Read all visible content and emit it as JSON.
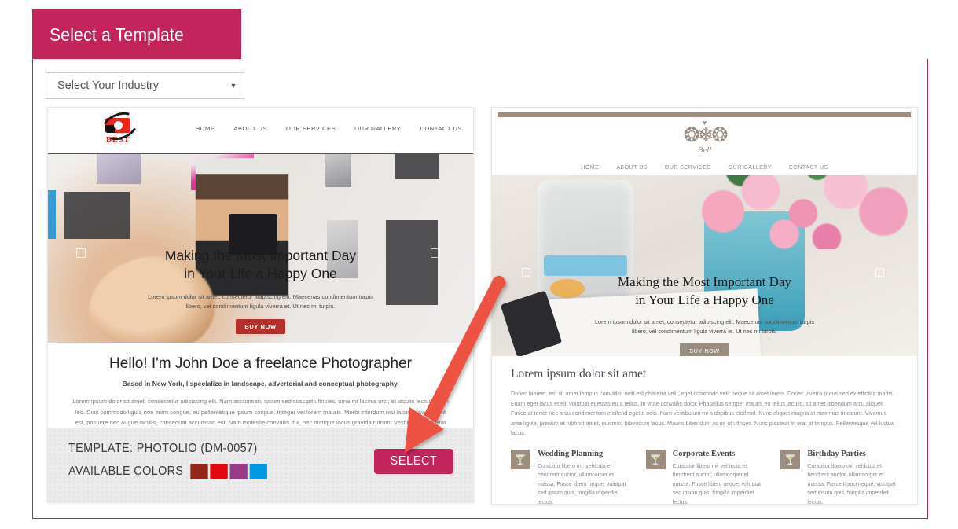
{
  "header": {
    "title": "Select a Template",
    "accent_color": "#c4245c"
  },
  "industry_select": {
    "value": "Select Your Industry",
    "caret": "▼"
  },
  "templates": [
    {
      "id": "photolio",
      "logo": {
        "brand": "BEST",
        "icon": "camera-icon"
      },
      "nav": [
        "HOME",
        "ABOUT US",
        "OUR SERVICES",
        "OUR GALLERY",
        "CONTACT US"
      ],
      "hero": {
        "heading_line1": "Making the Most Important Day",
        "heading_line2": "in Your Life a Happy One",
        "paragraph": "Lorem ipsum dolor sit amet, consectetur adipiscing elit. Maecenas condimentum turpis libero, vel condimentum ligula viverra et. Ut nec mi turpis.",
        "cta": "BUY NOW"
      },
      "body": {
        "title": "Hello! I'm John Doe a freelance Photographer",
        "subtitle": "Based in New York, I specialize in landscape, advertorial and conceptual photography.",
        "paragraph": "Lorem ipsum dolor sit amet, consectetur adipiscing elit. Nam accumsan, ipsum sed suscipit ultricies, urna mi lacinia orci, et iaculis lectus nisi in leo. Duis commodo ligula non enim congue, eu pellentesque ipsum congue. Integer vel lorem mauris. Morbi interdum nisi lacus. Vivamus elit est, posuere nec augue iaculis, consequat accumsan est. Nam molestie convallis dui, nec tristique lacus gravida rutrum. Vestibulum placerat magna odio, in viverra justo tincidunt sed. Vestibulum maximus orci placerat hendrerit elementum."
      },
      "footer": {
        "template_label": "TEMPLATE: PHOTOLIO (DM-0057)",
        "colors_label": "AVAILABLE COLORS",
        "colors": [
          "#94251b",
          "#e30613",
          "#963c86",
          "#0099e0"
        ],
        "select_button": "SELECT"
      }
    },
    {
      "id": "wedding",
      "logo": {
        "brand": "Bell",
        "icon": "floral-crest-icon"
      },
      "nav": [
        "HOME",
        "ABOUT US",
        "OUR SERVICES",
        "OUR GALLERY",
        "CONTACT US"
      ],
      "hero": {
        "heading_line1": "Making the Most Important Day",
        "heading_line2": "in Your Life a Happy One",
        "paragraph": "Lorem ipsum dolor sit amet, consectetur adipiscing elit. Maecenas condimentum turpis libero, vel condimentum ligula viverra et. Ut nec mi turpis.",
        "cta": "BUY NOW"
      },
      "body": {
        "title": "Lorem ipsum dolor sit amet",
        "paragraph": "Donec laoreet, est sit amet tempus convallis, velit est pharetra velit, eget commodo velit neque sit amet lorem. Donec viverra purus sed ex efficitur mattis. Etiam eget lacus et elit volutpat egestas eu a tellus. In vitae convallis dolor. Phasellus semper mauris eu tellus iaculis, sit amet bibendum arcu aliquet. Fusce at tortor nec arcu condimentum eleifend eget a odio. Nam vestibulum mi a dapibus eleifend. Nunc aliquet magna at maximus tincidunt. Vivamus ante ligula, pretium et nibh sit amet, euismod bibendum lacus. Mauris bibendum ac ex at ultrices. Nunc placerat in erat at tempus. Pellentesque vel luctus lacus."
      },
      "services": [
        {
          "icon": "cocktail-glass-icon",
          "title": "Wedding Planning",
          "text": "Curabitur libero mi, vehicula et hendrerit auctor, ullamcorper et massa. Fusce libero neque, volutpat sed ipsum quis, fringilla imperdiet lectus."
        },
        {
          "icon": "cocktail-glass-icon",
          "title": "Corporate Events",
          "text": "Curabitur libero mi, vehicula et hendrerit auctor, ullamcorper et massa. Fusce libero neque, volutpat sed ipsum quis, fringilla imperdiet lectus."
        },
        {
          "icon": "cocktail-glass-icon",
          "title": "Birthday Parties",
          "text": "Curabitur libero mi, vehicula et hendrerit auctor, ullamcorper et massa. Fusce libero neque, volutpat sed ipsum quis, fringilla imperdiet lectus."
        }
      ]
    }
  ],
  "annotation": {
    "type": "arrow",
    "color": "#ec5242",
    "points_to": "select-button"
  }
}
